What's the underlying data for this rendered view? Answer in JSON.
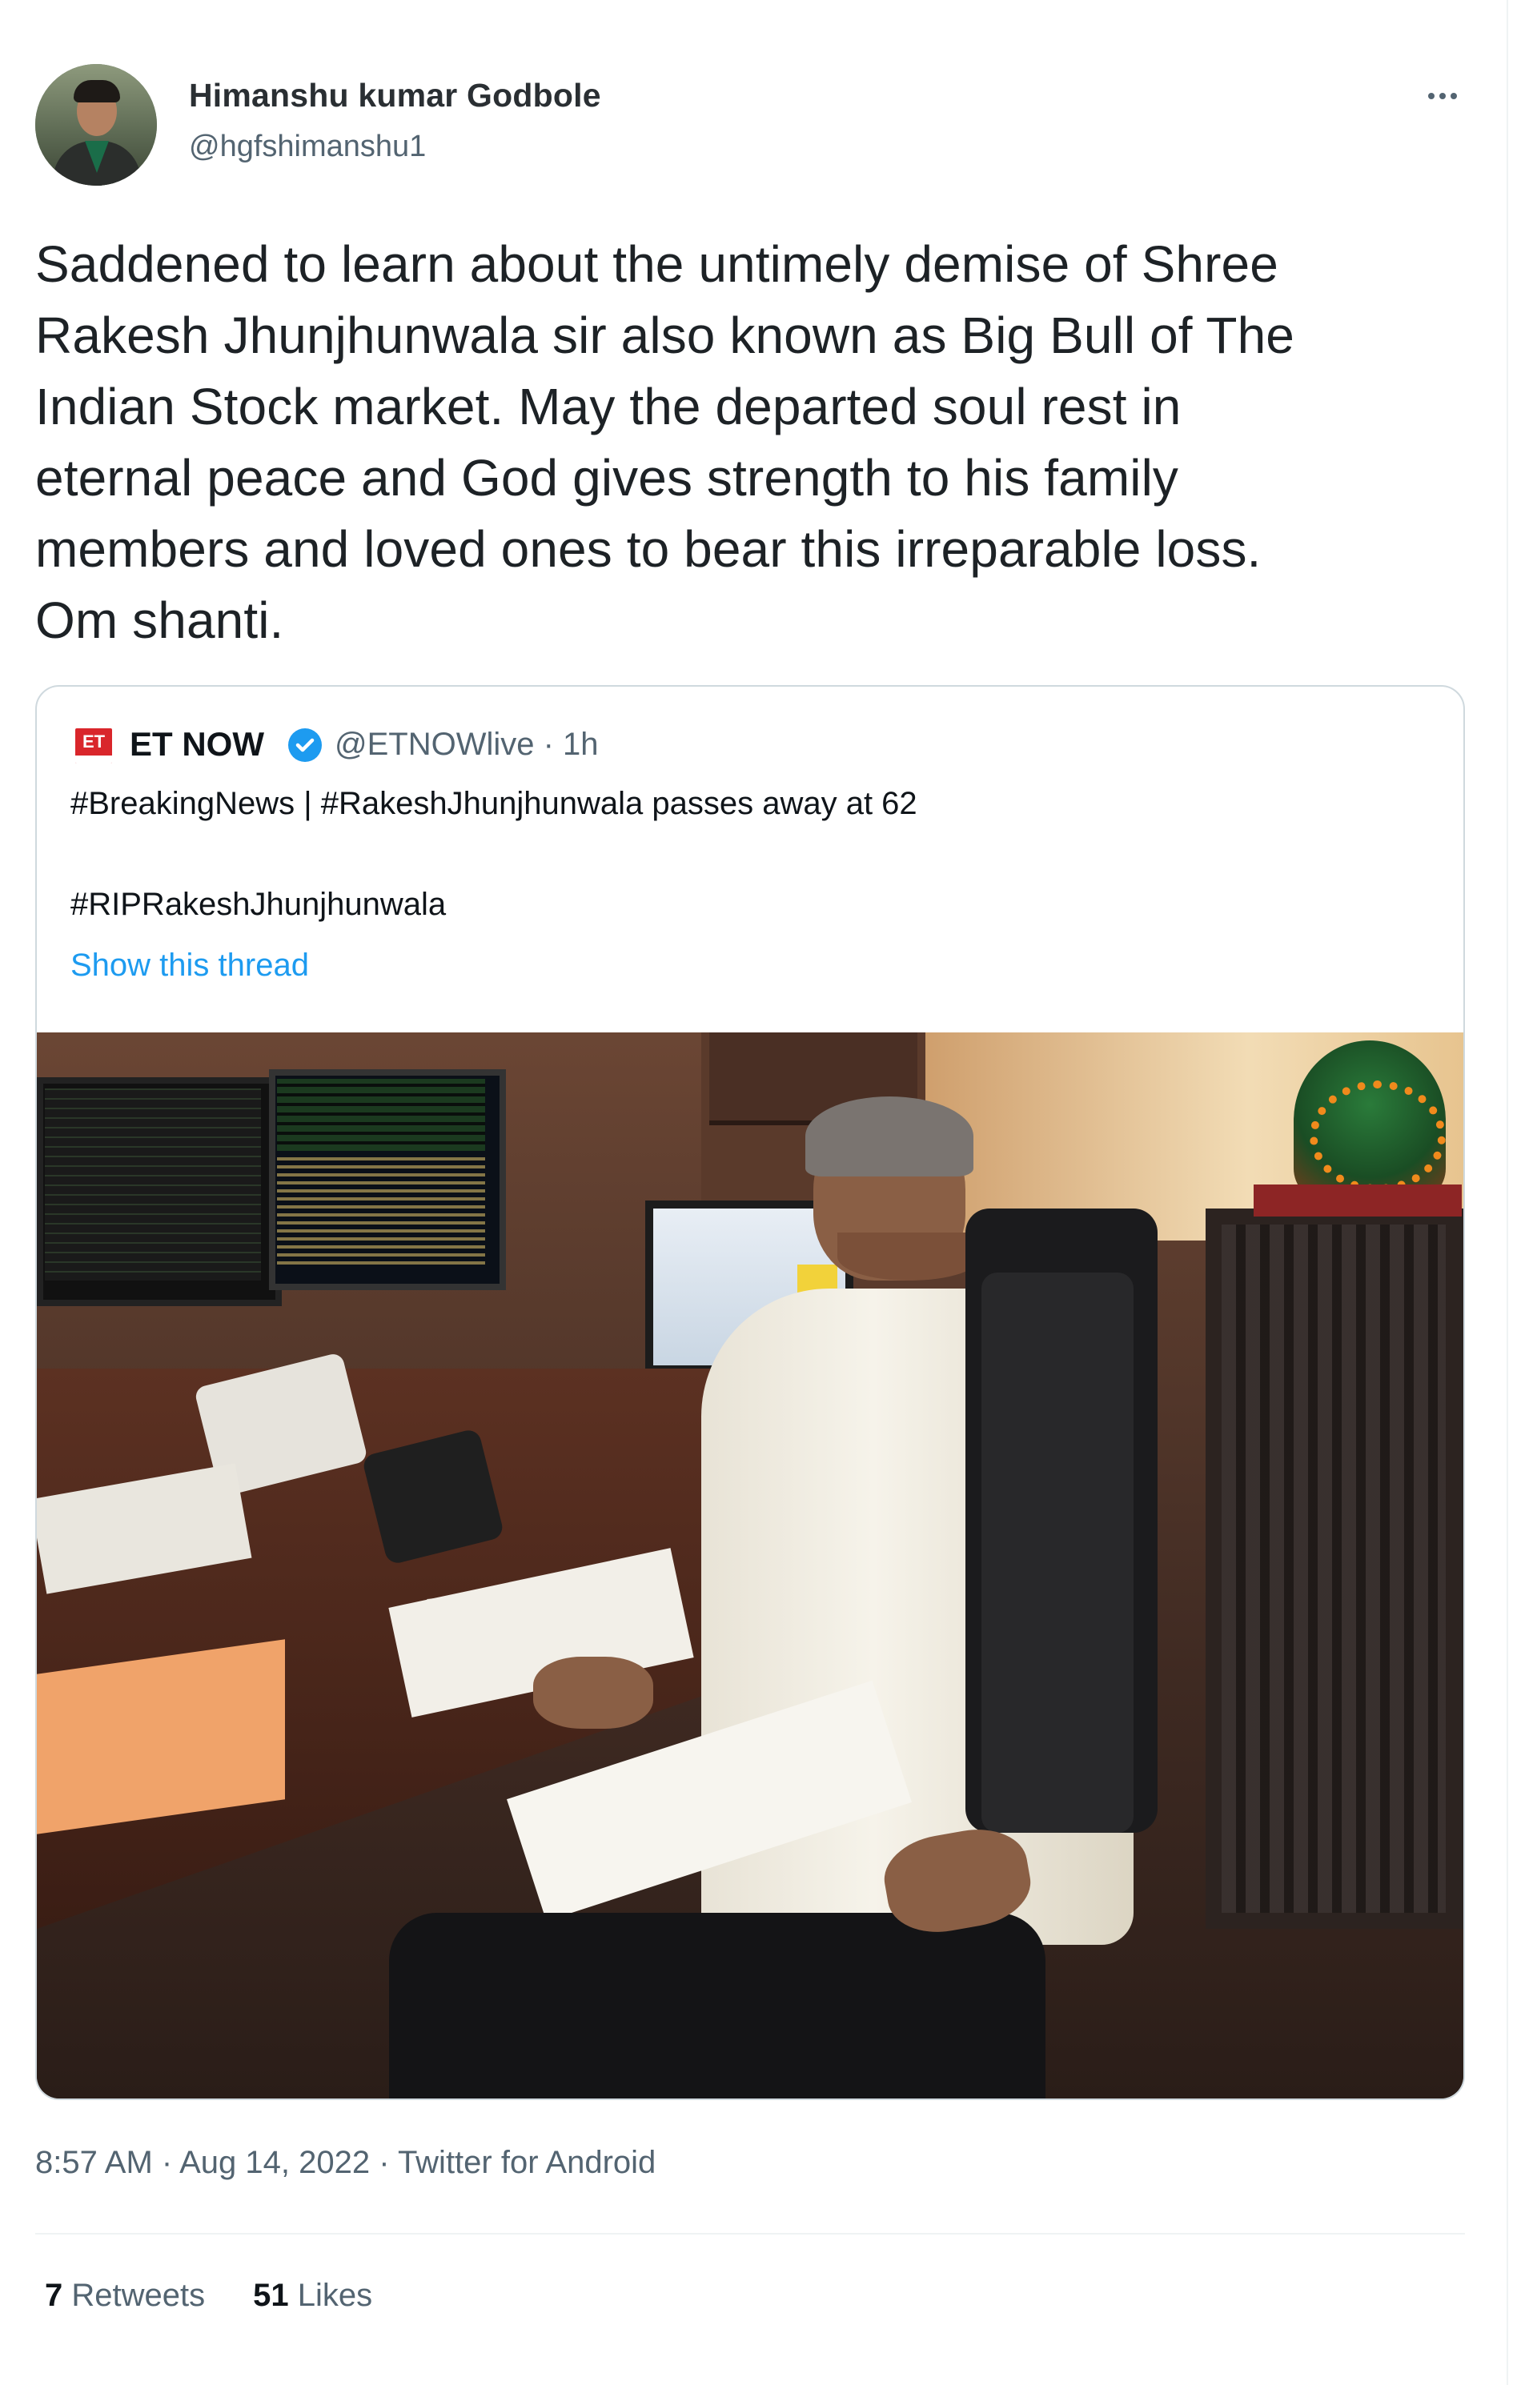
{
  "author": {
    "name": "Himanshu kumar Godbole",
    "handle": "@hgfshimanshu1"
  },
  "tweet": {
    "lines": [
      "Saddened to learn about the untimely demise of Shree",
      "Rakesh Jhunjhunwala sir also known as Big Bull of The",
      "Indian Stock market. May the departed soul rest in",
      "eternal peace and God gives strength to his family",
      "members and loved ones to bear this irreparable loss.",
      "Om shanti."
    ]
  },
  "quoted": {
    "logo_text": "ET",
    "name": "ET NOW",
    "handle_time": "@ETNOWlive · 1h",
    "text_line1": "#BreakingNews | #RakeshJhunjhunwala passes away at 62",
    "text_line2": "#RIPRakeshJhunjhunwala",
    "show_thread": "Show this thread"
  },
  "meta": {
    "time": "8:57 AM",
    "date": "Aug 14, 2022",
    "source": "Twitter for Android"
  },
  "stats": {
    "retweets_count": "7",
    "retweets_label": "Retweets",
    "likes_count": "51",
    "likes_label": "Likes"
  },
  "colors": {
    "link": "#1d9bf0",
    "muted": "#536471",
    "border": "#cfd9de"
  },
  "icons": [
    "more-icon",
    "verified-badge-icon",
    "et-now-logo"
  ]
}
